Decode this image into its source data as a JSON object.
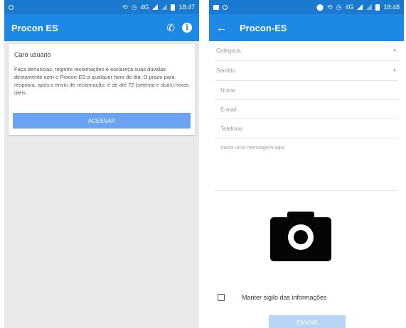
{
  "left_screen": {
    "status_bar": {
      "signal_label": "4G",
      "time": "18:47"
    },
    "app_bar": {
      "title": "Procon ES",
      "call_icon": "phone-icon",
      "info_icon": "info-icon"
    },
    "card": {
      "title": "Caro usuário",
      "text": "Faça denúncias, registre reclamações e esclareça suas dúvidas diretamente com o Procon-ES a qualquer hora do dia. O prazo para resposta, após o envio de reclamação, é de até 72 (setenta e duas) horas úteis.",
      "button_label": "ACESSAR"
    }
  },
  "right_screen": {
    "status_bar": {
      "signal_label": "4G",
      "time": "18:48"
    },
    "app_bar": {
      "title": "Procon-ES",
      "back_icon": "back-arrow-icon"
    },
    "form": {
      "category_placeholder": "Categoria",
      "direction_placeholder": "Sentido",
      "name_placeholder": "Nome",
      "email_placeholder": "E-mail",
      "phone_placeholder": "Telefone",
      "message_placeholder": "Insira uma mensagem aqui"
    },
    "camera_icon": "camera-icon",
    "privacy_checkbox_label": "Manter sigilo das informações",
    "send_button_label": "ENVIAR"
  },
  "colors": {
    "status_bar": "#1a7ad0",
    "app_bar": "#1e88e5",
    "primary_button": "#6aa3f2",
    "disabled_button": "#b8d4f7"
  }
}
